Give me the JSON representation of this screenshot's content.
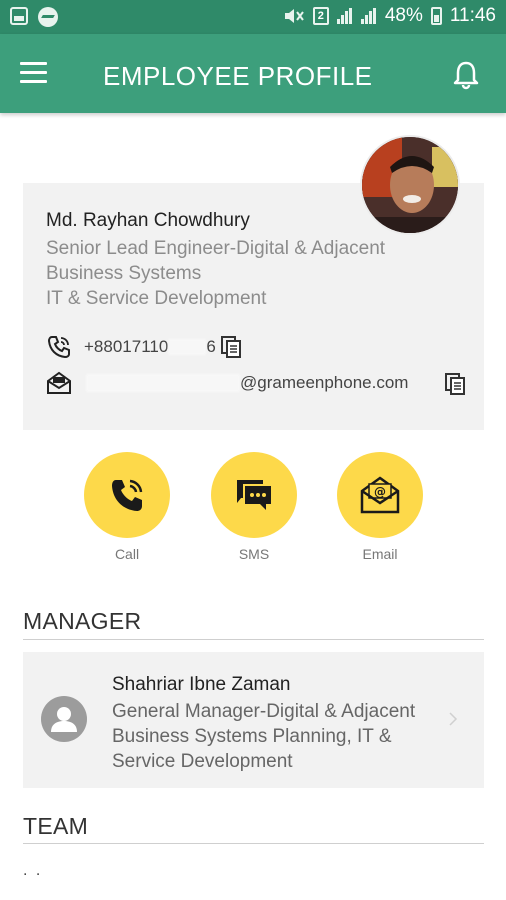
{
  "status_bar": {
    "battery": "48%",
    "time": "11:46",
    "sim": "2"
  },
  "app_bar": {
    "title": "EMPLOYEE PROFILE"
  },
  "profile": {
    "name": "Md. Rayhan Chowdhury",
    "designation_line1": "Senior Lead Engineer-Digital & Adjacent",
    "designation_line2": "Business Systems",
    "department": "IT & Service Development",
    "phone_prefix": "+88017110",
    "phone_suffix": "6",
    "email_domain": "@grameenphone.com"
  },
  "actions": {
    "call_label": "Call",
    "sms_label": "SMS",
    "email_label": "Email"
  },
  "manager_section": {
    "title": "MANAGER",
    "name": "Shahriar Ibne Zaman",
    "line1": "General Manager-Digital & Adjacent",
    "line2": "Business Systems Planning, IT &",
    "line3": "Service Development"
  },
  "team_section": {
    "title": "TEAM",
    "placeholder": ". ."
  },
  "colors": {
    "status_bar": "#2f8a69",
    "app_bar": "#3d9f7c",
    "action_yellow": "#fdd94a",
    "card_bg": "#f2f2f2"
  }
}
